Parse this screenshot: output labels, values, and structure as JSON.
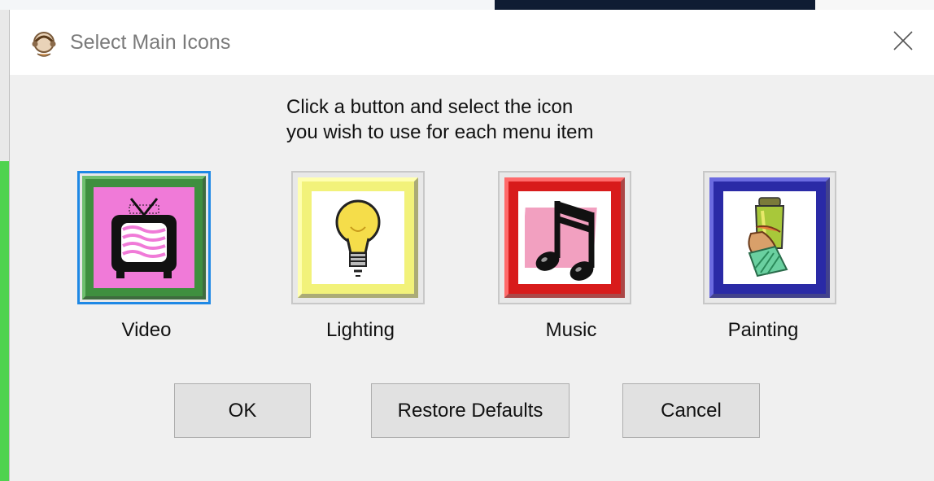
{
  "window": {
    "title": "Select Main Icons",
    "app_icon": "app-logo-icon",
    "close_icon": "close-icon"
  },
  "instructions": {
    "line1": "Click a button and select the icon",
    "line2": "you wish to use for each menu item"
  },
  "icon_buttons": [
    {
      "label": "Video",
      "icon": "tv-icon",
      "frame_color": "#3f8f3f",
      "bg_color": "#f07ad8",
      "selected": true
    },
    {
      "label": "Lighting",
      "icon": "light-bulb-icon",
      "frame_color": "#f2f27a",
      "bg_color": "#ffffff",
      "selected": false
    },
    {
      "label": "Music",
      "icon": "music-note-icon",
      "frame_color": "#d81b1b",
      "bg_color": "#ffffff",
      "selected": false
    },
    {
      "label": "Painting",
      "icon": "paint-tube-icon",
      "frame_color": "#2a2aa6",
      "bg_color": "#ffffff",
      "selected": false
    }
  ],
  "buttons": {
    "ok": "OK",
    "restore": "Restore Defaults",
    "cancel": "Cancel"
  },
  "colors": {
    "dialog_bg": "#f0f0f0",
    "button_bg": "#e1e1e1",
    "focus_border": "#1e88e5"
  }
}
